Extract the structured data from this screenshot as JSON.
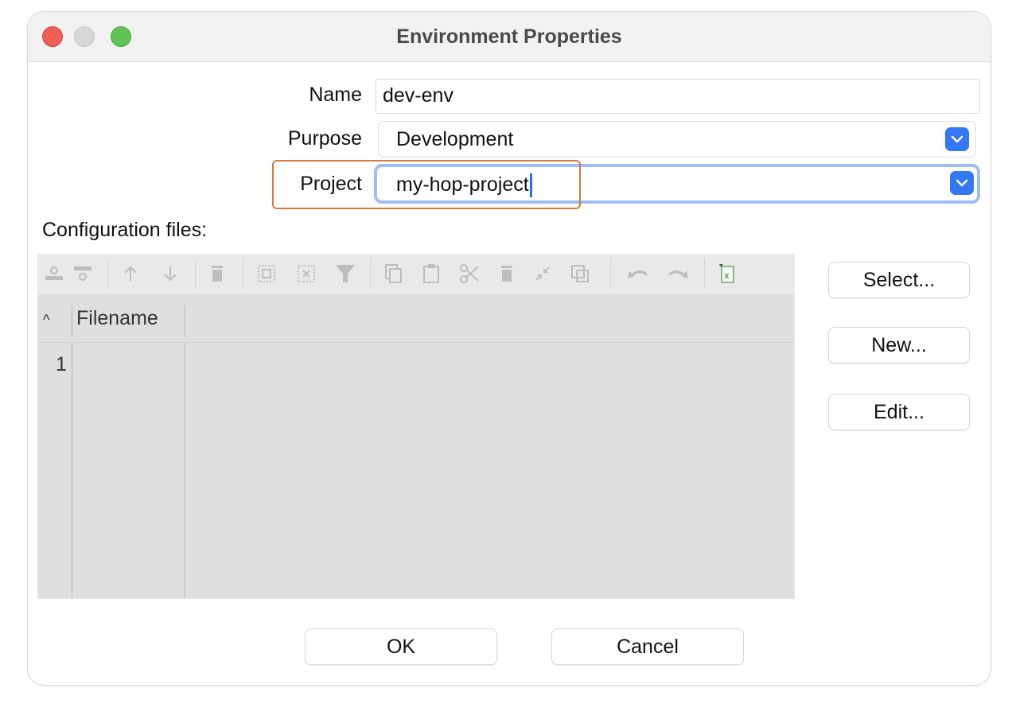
{
  "window": {
    "title": "Environment Properties"
  },
  "form": {
    "name_label": "Name",
    "name_value": "dev-env",
    "purpose_label": "Purpose",
    "purpose_value": "Development",
    "project_label": "Project",
    "project_value": "my-hop-project"
  },
  "config": {
    "section_label": "Configuration files:",
    "column_header": "Filename",
    "row_numbers": [
      "1"
    ]
  },
  "side_buttons": {
    "select": "Select...",
    "new": "New...",
    "edit": "Edit..."
  },
  "footer": {
    "ok": "OK",
    "cancel": "Cancel"
  },
  "toolbar_icons": [
    "insert-row-before-icon",
    "insert-row-after-icon",
    "move-up-icon",
    "move-down-icon",
    "delete-icon",
    "select-all-icon",
    "clear-selection-icon",
    "filter-icon",
    "copy-icon",
    "paste-icon",
    "cut-icon",
    "delete-selected-icon",
    "optimal-column-width-icon",
    "duplicate-icon",
    "undo-icon",
    "redo-icon",
    "export-excel-icon"
  ],
  "colors": {
    "accent": "#3478f6",
    "highlight_box": "#d97a3a",
    "close": "#ed5f57",
    "maximize": "#5fc454"
  }
}
